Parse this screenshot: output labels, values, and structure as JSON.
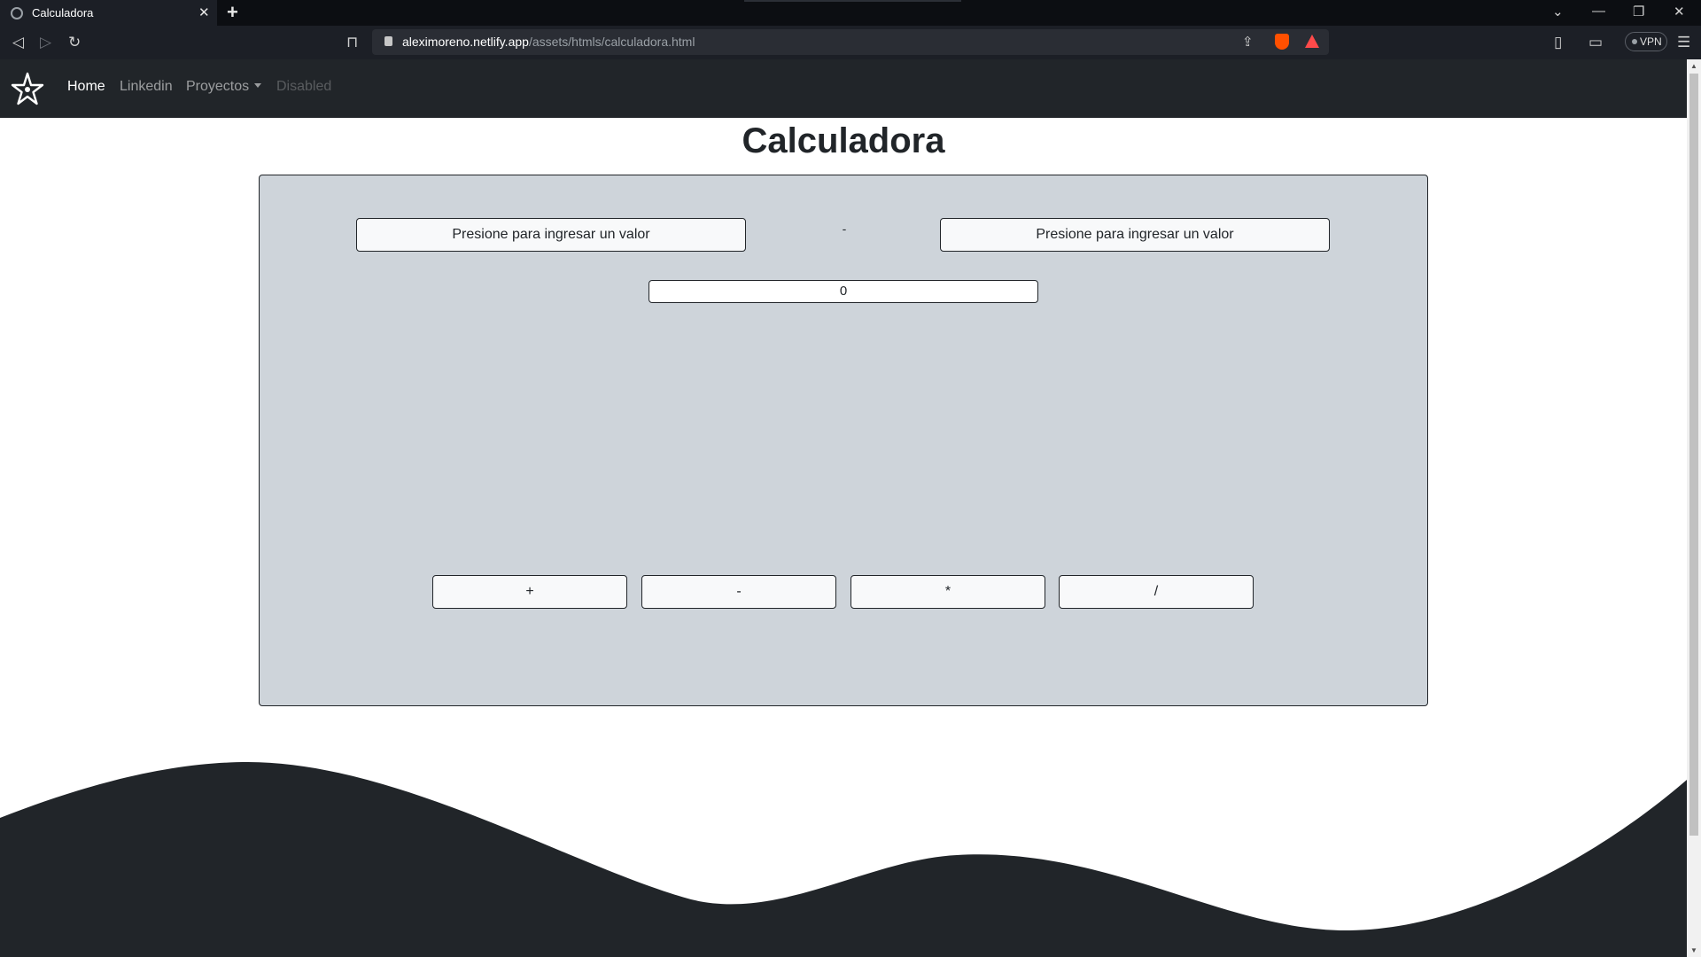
{
  "browser": {
    "tab_title": "Calculadora",
    "tab_close": "✕",
    "new_tab": "+",
    "url_host": "aleximoreno.netlify.app",
    "url_path": "/assets/htmls/calculadora.html",
    "vpn_label": "VPN",
    "window_controls": [
      "⌄",
      "—",
      "❐",
      "✕"
    ]
  },
  "navbar": {
    "links": [
      {
        "label": "Home",
        "state": "active"
      },
      {
        "label": "Linkedin",
        "state": "normal"
      },
      {
        "label": "Proyectos",
        "state": "dropdown"
      },
      {
        "label": "Disabled",
        "state": "disabled"
      }
    ]
  },
  "page": {
    "title": "Calculadora"
  },
  "calculator": {
    "value1_label": "Presione para ingresar un valor",
    "value2_label": "Presione para ingresar un valor",
    "operator_display": "-",
    "result": "0",
    "operations": [
      "+",
      "-",
      "*",
      "/"
    ]
  },
  "colors": {
    "navbar_bg": "#212529",
    "card_bg": "#ced4da",
    "button_bg": "#f8f9fa",
    "wave": "#212529"
  }
}
